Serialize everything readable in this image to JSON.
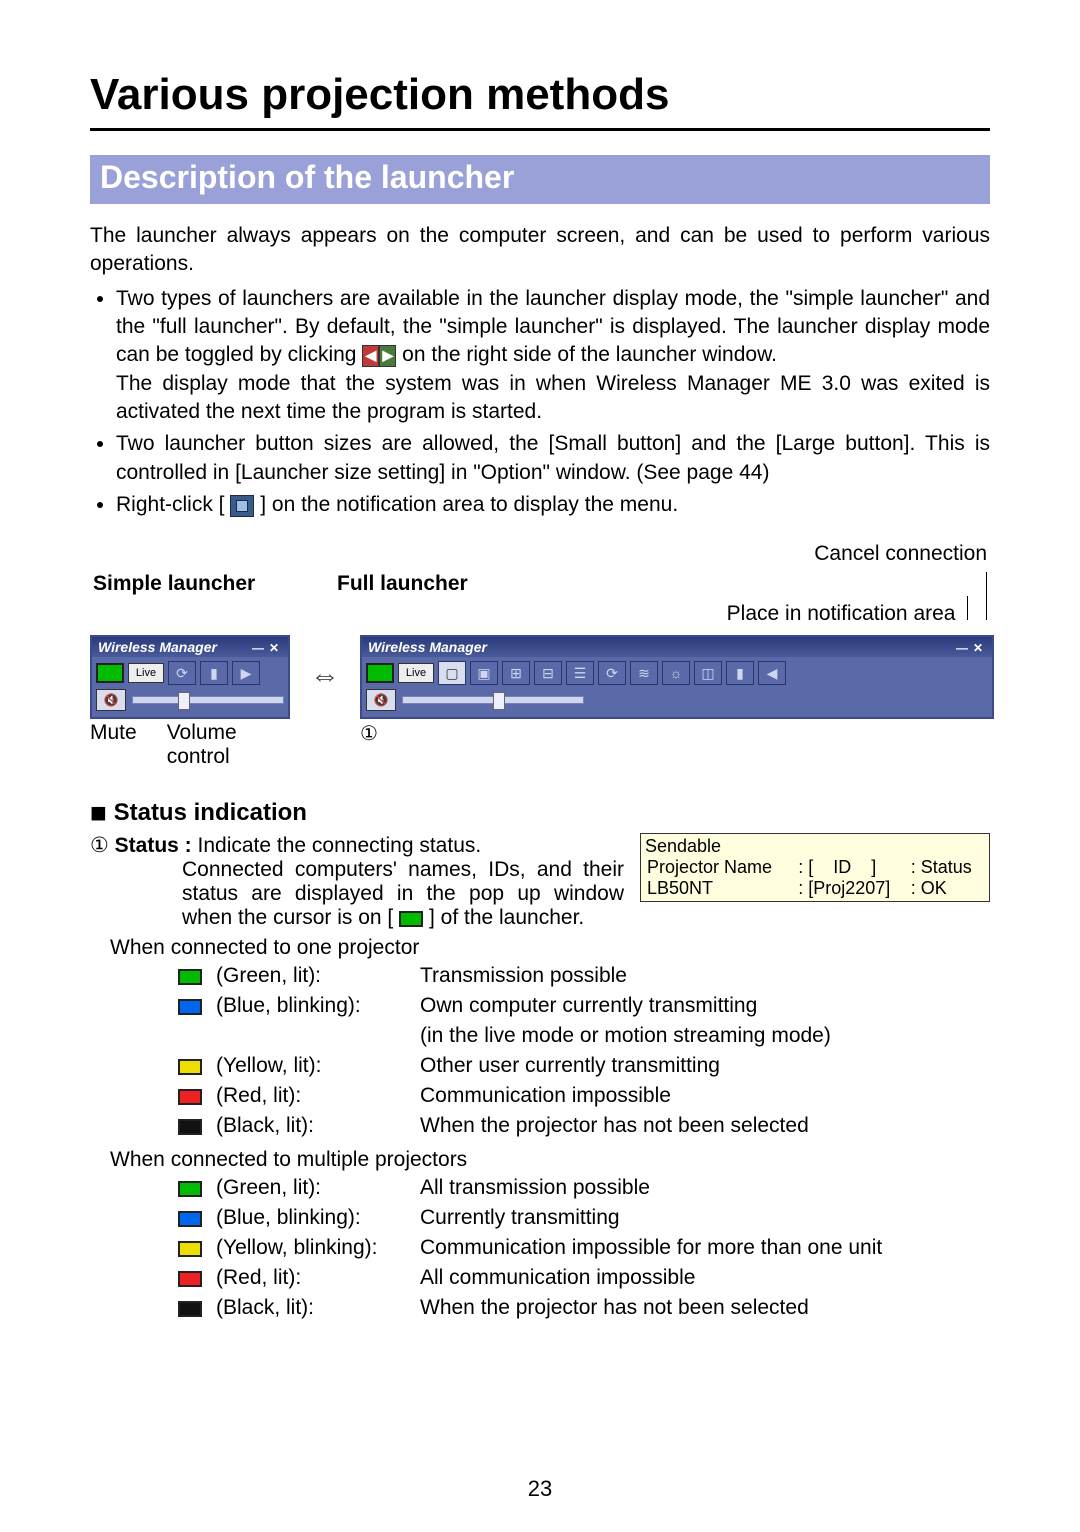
{
  "page_number": "23",
  "title": "Various projection methods",
  "section_header": "Description of the launcher",
  "intro_para": "The launcher always appears on the computer screen, and can be used to perform various operations.",
  "bullets": [
    "Two types of launchers are available in the launcher display mode, the \"simple launcher\" and the \"full launcher\". By default, the \"simple launcher\" is displayed. The launcher display mode can be toggled by clicking ",
    " on the right side of the launcher window.",
    "The display mode that the system was in when Wireless Manager ME 3.0 was exited is activated the next time the program is started.",
    "Two launcher button sizes are allowed, the [Small button] and the [Large button]. This is controlled in [Launcher size setting] in \"Option\" window. (See page 44)",
    "Right-click [",
    "] on the notification area to display the menu."
  ],
  "labels": {
    "simple": "Simple launcher",
    "full": "Full launcher",
    "place_notif": "Place in notification area",
    "cancel": "Cancel connection",
    "mute": "Mute",
    "volume": "Volume control",
    "ref1": "①"
  },
  "launcher_ui": {
    "title": "Wireless Manager",
    "live": "Live"
  },
  "status_heading": "Status indication",
  "status_line_prefix": "① ",
  "status_line_label": "Status :",
  "status_line_text1": " Indicate the connecting status.",
  "status_line_text2": "Connected computers' names, IDs, and their status are displayed in the pop up window when the cursor is on [",
  "status_line_text3": "] of the launcher.",
  "tooltip": {
    "header": "Sendable",
    "col_name": "Projector Name",
    "col_id": "ID",
    "col_status": "Status",
    "row_name": "LB50NT",
    "row_id": "[Proj2207]",
    "row_status": "OK"
  },
  "single_proj_heading": "When connected to one projector",
  "multi_proj_heading": "When connected to multiple projectors",
  "colors_single": [
    {
      "c": "green",
      "label": "(Green, lit):",
      "desc": "Transmission possible"
    },
    {
      "c": "blue",
      "label": "(Blue, blinking):",
      "desc": "Own computer currently transmitting"
    },
    {
      "c": "blue",
      "label": "",
      "desc": "(in the live mode or motion streaming mode)"
    },
    {
      "c": "yellow",
      "label": "(Yellow, lit):",
      "desc": "Other user currently transmitting"
    },
    {
      "c": "red",
      "label": "(Red, lit):",
      "desc": "Communication impossible"
    },
    {
      "c": "black",
      "label": "(Black, lit):",
      "desc": "When the projector has not been selected"
    }
  ],
  "colors_multi": [
    {
      "c": "green",
      "label": "(Green, lit):",
      "desc": "All transmission possible"
    },
    {
      "c": "blue",
      "label": "(Blue, blinking):",
      "desc": "Currently transmitting"
    },
    {
      "c": "yellow",
      "label": "(Yellow, blinking):",
      "desc": "Communication impossible for more than one unit"
    },
    {
      "c": "red",
      "label": "(Red, lit):",
      "desc": "All communication impossible"
    },
    {
      "c": "black",
      "label": "(Black, lit):",
      "desc": "When the projector has not been selected"
    }
  ]
}
